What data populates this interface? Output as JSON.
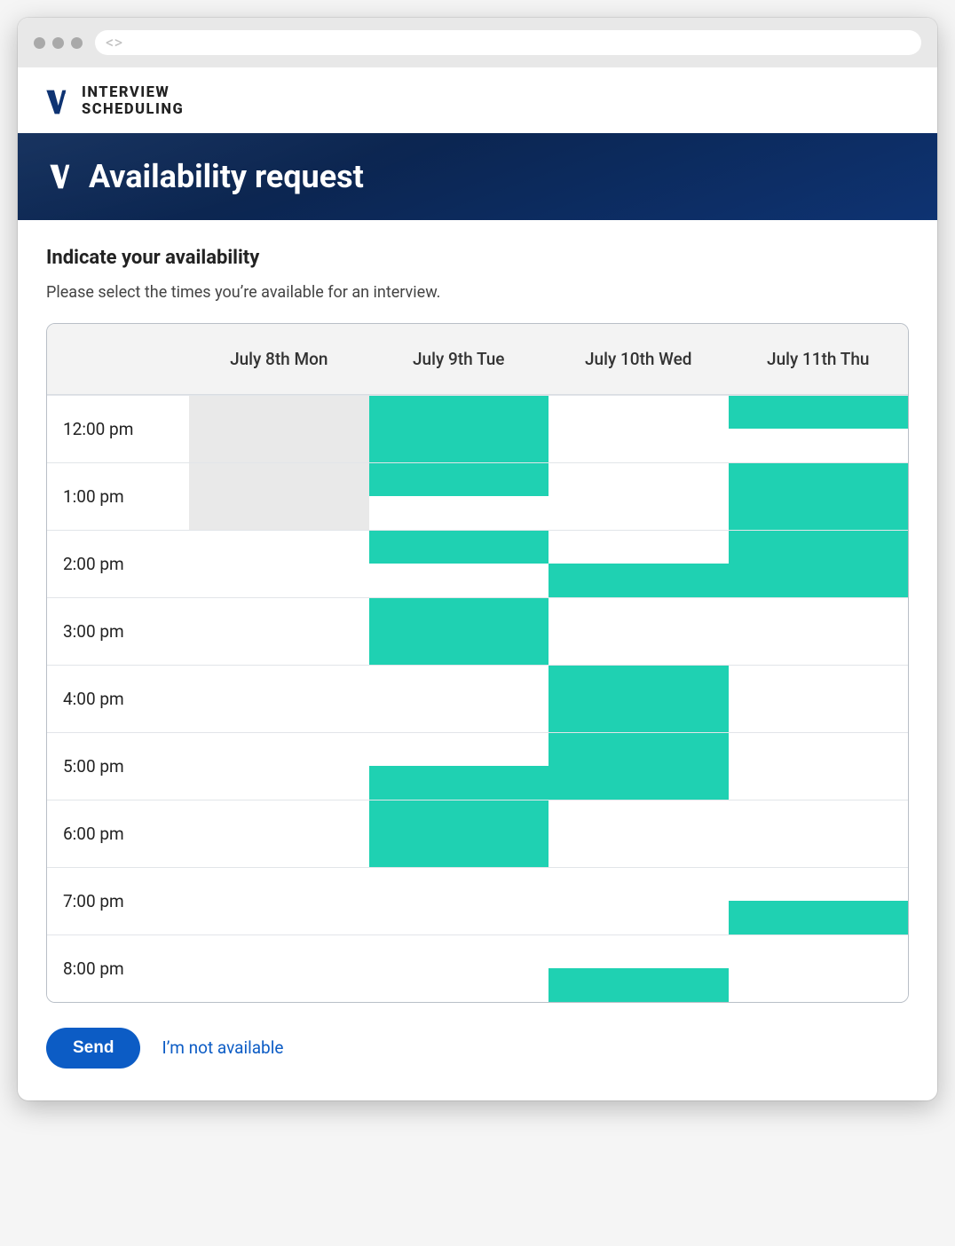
{
  "app": {
    "title_line1": "INTERVIEW",
    "title_line2": "SCHEDULING"
  },
  "hero": {
    "title": "Availability request"
  },
  "main": {
    "subtitle": "Indicate your availability",
    "description": "Please select the times you’re available for an interview."
  },
  "grid": {
    "days": [
      "July 8th Mon",
      "July 9th Tue",
      "July 10th Wed",
      "July 11th Thu"
    ],
    "times": [
      "12:00 pm",
      "1:00 pm",
      "2:00 pm",
      "3:00 pm",
      "4:00 pm",
      "5:00 pm",
      "6:00 pm",
      "7:00 pm",
      "8:00 pm"
    ],
    "slots": [
      [
        [
          "disabled",
          "disabled"
        ],
        [
          "selected",
          "selected"
        ],
        [
          "",
          ""
        ],
        [
          "selected",
          ""
        ]
      ],
      [
        [
          "disabled",
          "disabled"
        ],
        [
          "selected",
          ""
        ],
        [
          "",
          ""
        ],
        [
          "selected",
          "selected"
        ]
      ],
      [
        [
          "",
          ""
        ],
        [
          "selected",
          ""
        ],
        [
          "",
          "selected"
        ],
        [
          "selected",
          "selected"
        ]
      ],
      [
        [
          "",
          ""
        ],
        [
          "selected",
          "selected"
        ],
        [
          "",
          ""
        ],
        [
          "",
          ""
        ]
      ],
      [
        [
          "",
          ""
        ],
        [
          "",
          ""
        ],
        [
          "selected",
          "selected"
        ],
        [
          "",
          ""
        ]
      ],
      [
        [
          "",
          ""
        ],
        [
          "",
          "selected"
        ],
        [
          "selected",
          "selected"
        ],
        [
          "",
          ""
        ]
      ],
      [
        [
          "",
          ""
        ],
        [
          "selected",
          "selected"
        ],
        [
          "",
          ""
        ],
        [
          "",
          ""
        ]
      ],
      [
        [
          "",
          ""
        ],
        [
          "",
          ""
        ],
        [
          "",
          ""
        ],
        [
          "",
          "selected"
        ]
      ],
      [
        [
          "",
          ""
        ],
        [
          "",
          ""
        ],
        [
          "",
          "selected"
        ],
        [
          "",
          ""
        ]
      ]
    ]
  },
  "actions": {
    "send_label": "Send",
    "not_available_label": "I’m not available"
  },
  "colors": {
    "selected": "#1fd1b2",
    "disabled": "#e9e9e9",
    "primary": "#0c5cc5",
    "hero_bg_start": "#0d2a58",
    "hero_bg_end": "#0e3372"
  }
}
